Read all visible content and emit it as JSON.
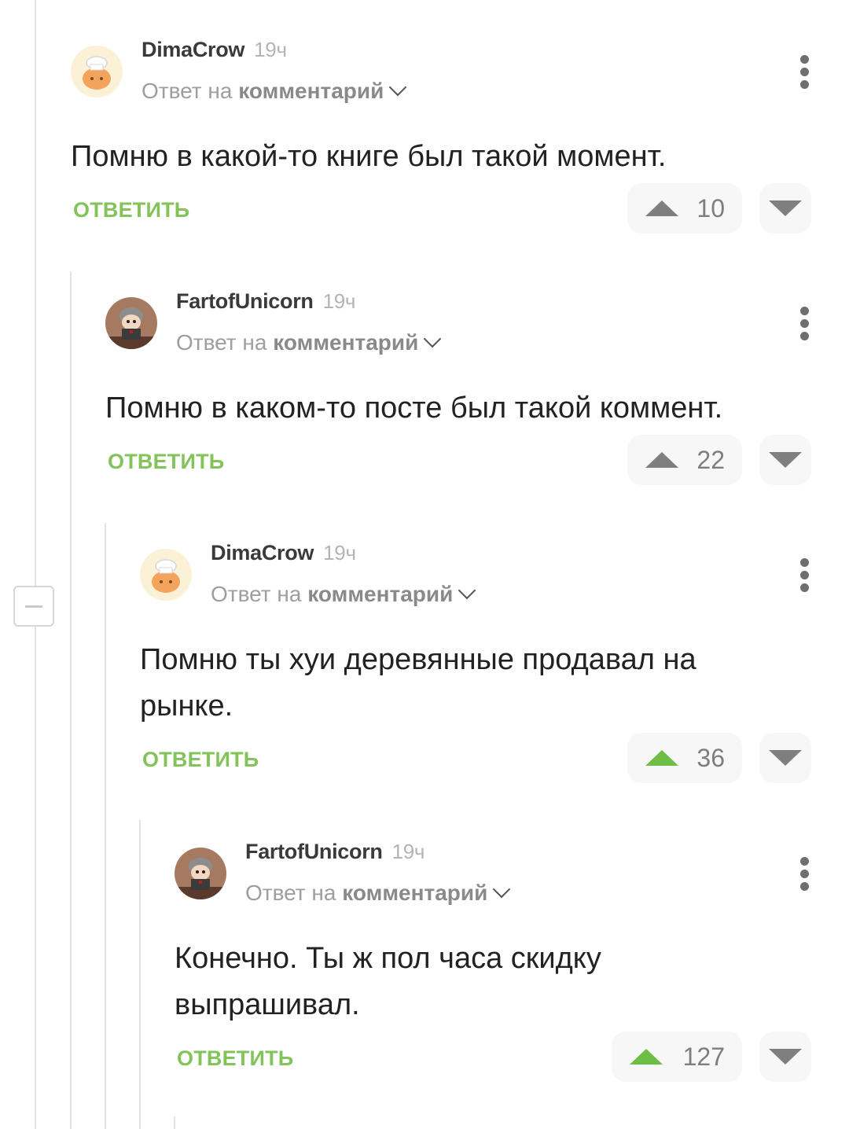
{
  "comments": [
    {
      "username": "DimaCrow",
      "time": "19ч",
      "reply_prefix": "Ответ на",
      "reply_target": "комментарий",
      "text": "Помню в какой-то книге был такой момент.",
      "reply_label": "ОТВЕТИТЬ",
      "rating": "10",
      "avatar": "chef-avatar",
      "upvoted": false
    },
    {
      "username": "FartofUnicorn",
      "time": "19ч",
      "reply_prefix": "Ответ на",
      "reply_target": "комментарий",
      "text": "Помню в каком-то посте был такой коммент.",
      "reply_label": "ОТВЕТИТЬ",
      "rating": "22",
      "avatar": "cartoon-character-avatar",
      "upvoted": false
    },
    {
      "username": "DimaCrow",
      "time": "19ч",
      "reply_prefix": "Ответ на",
      "reply_target": "комментарий",
      "text": "Помню ты хуи деревянные продавал на рынке.",
      "reply_label": "ОТВЕТИТЬ",
      "rating": "36",
      "avatar": "chef-avatar",
      "upvoted": true
    },
    {
      "username": "FartofUnicorn",
      "time": "19ч",
      "reply_prefix": "Ответ на",
      "reply_target": "комментарий",
      "text": "Конечно. Ты ж пол часа скидку выпрашивал.",
      "reply_label": "ОТВЕТИТЬ",
      "rating": "127",
      "avatar": "cartoon-character-avatar",
      "upvoted": true
    }
  ],
  "colors": {
    "accent_green": "#82c35a",
    "upvote_green": "#6ebd45",
    "vote_grey": "#7f7f7f"
  },
  "icons": [
    "collapse-thread-icon",
    "more-options-icon",
    "chevron-down-icon",
    "upvote-icon",
    "downvote-icon"
  ]
}
